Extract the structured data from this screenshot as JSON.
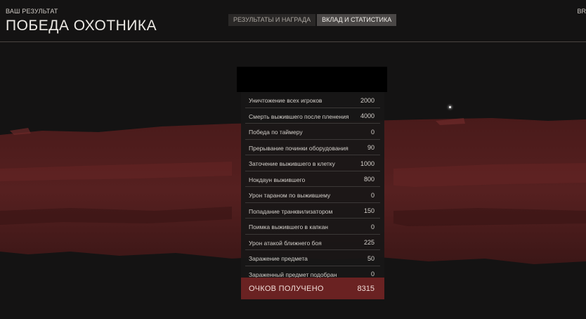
{
  "header": {
    "subtitle": "ВАШ РЕЗУЛЬТАТ",
    "title": "ПОБЕДА ОХОТНИКА",
    "right_text": "BR"
  },
  "tabs": [
    {
      "label": "РЕЗУЛЬТАТЫ И НАГРАДА",
      "active": false
    },
    {
      "label": "ВКЛАД И СТАТИСТИКА",
      "active": true
    }
  ],
  "stats": [
    {
      "label": "Уничтожение всех игроков",
      "value": "2000"
    },
    {
      "label": "Смерть выжившего после пленения",
      "value": "4000"
    },
    {
      "label": "Победа по таймеру",
      "value": "0"
    },
    {
      "label": "Прерывание починки оборудования",
      "value": "90"
    },
    {
      "label": "Заточение выжившего в клетку",
      "value": "1000"
    },
    {
      "label": "Нокдаун выжившего",
      "value": "800"
    },
    {
      "label": "Урон тараном по выжившему",
      "value": "0"
    },
    {
      "label": "Попадание транквилизатором",
      "value": "150"
    },
    {
      "label": "Поимка выжившего в капкан",
      "value": "0"
    },
    {
      "label": "Урон атакой ближнего боя",
      "value": "225"
    },
    {
      "label": "Заражение предмета",
      "value": "50"
    },
    {
      "label": "Зараженный предмет подобран",
      "value": "0"
    }
  ],
  "total": {
    "label": "ОЧКОВ ПОЛУЧЕНО",
    "value": "8315"
  },
  "colors": {
    "background": "#141313",
    "smear": "#5a2020",
    "total_bg": "#6a2222",
    "tab_active": "#4a4746"
  }
}
